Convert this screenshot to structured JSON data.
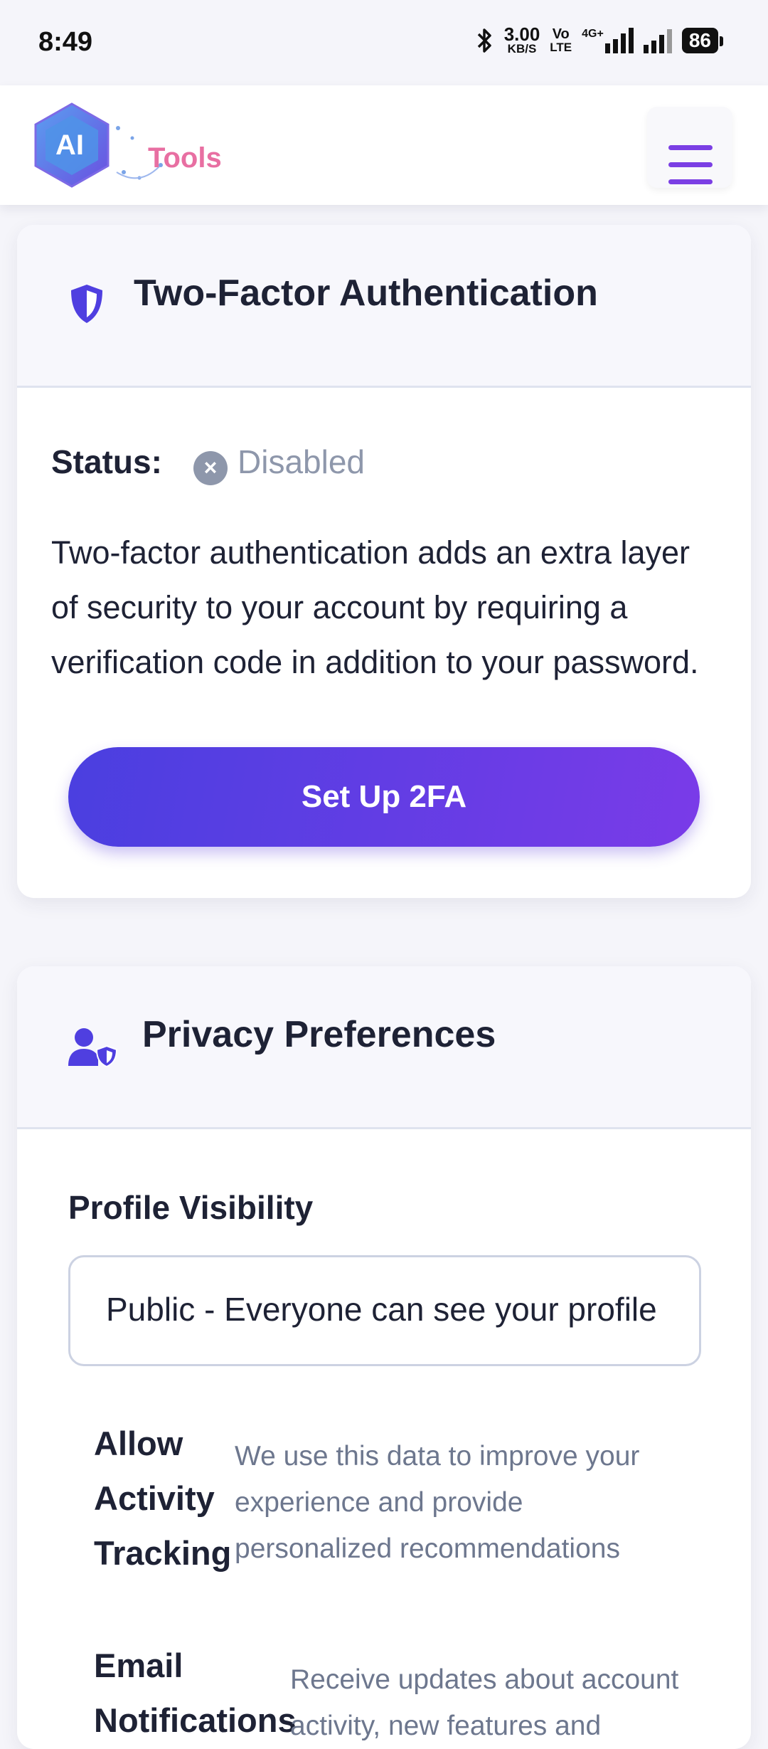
{
  "status_bar": {
    "time": "8:49",
    "net_speed": "3.00",
    "net_unit": "KB/S",
    "volte": "Vo",
    "lte": "LTE",
    "net_type": "4G+",
    "battery": "86"
  },
  "header": {
    "logo_badge": "AI",
    "logo_text": "Tools"
  },
  "two_factor": {
    "title": "Two-Factor Authentication",
    "status_label": "Status:",
    "status_value": "Disabled",
    "description": "Two-factor authentication adds an extra layer of security to your account by requiring a verification code in addition to your password.",
    "button_label": "Set Up 2FA"
  },
  "privacy": {
    "title": "Privacy Preferences",
    "visibility_label": "Profile Visibility",
    "visibility_value": "Public - Everyone can see your profile",
    "options": [
      {
        "title_lines": [
          "Allow",
          "Activity",
          "Tracking"
        ],
        "description_lines": [
          "We use this data to improve your",
          "experience and provide",
          "personalized recommendations"
        ]
      },
      {
        "title_lines": [
          "Email",
          "Notifications"
        ],
        "description_lines": [
          "Receive updates about account",
          "activity, new features and"
        ]
      }
    ]
  },
  "colors": {
    "accent": "#7b3fe4",
    "button_gradient_start": "#4a3fe0",
    "button_gradient_end": "#7a3be8",
    "status_disabled": "#8e97ab"
  }
}
